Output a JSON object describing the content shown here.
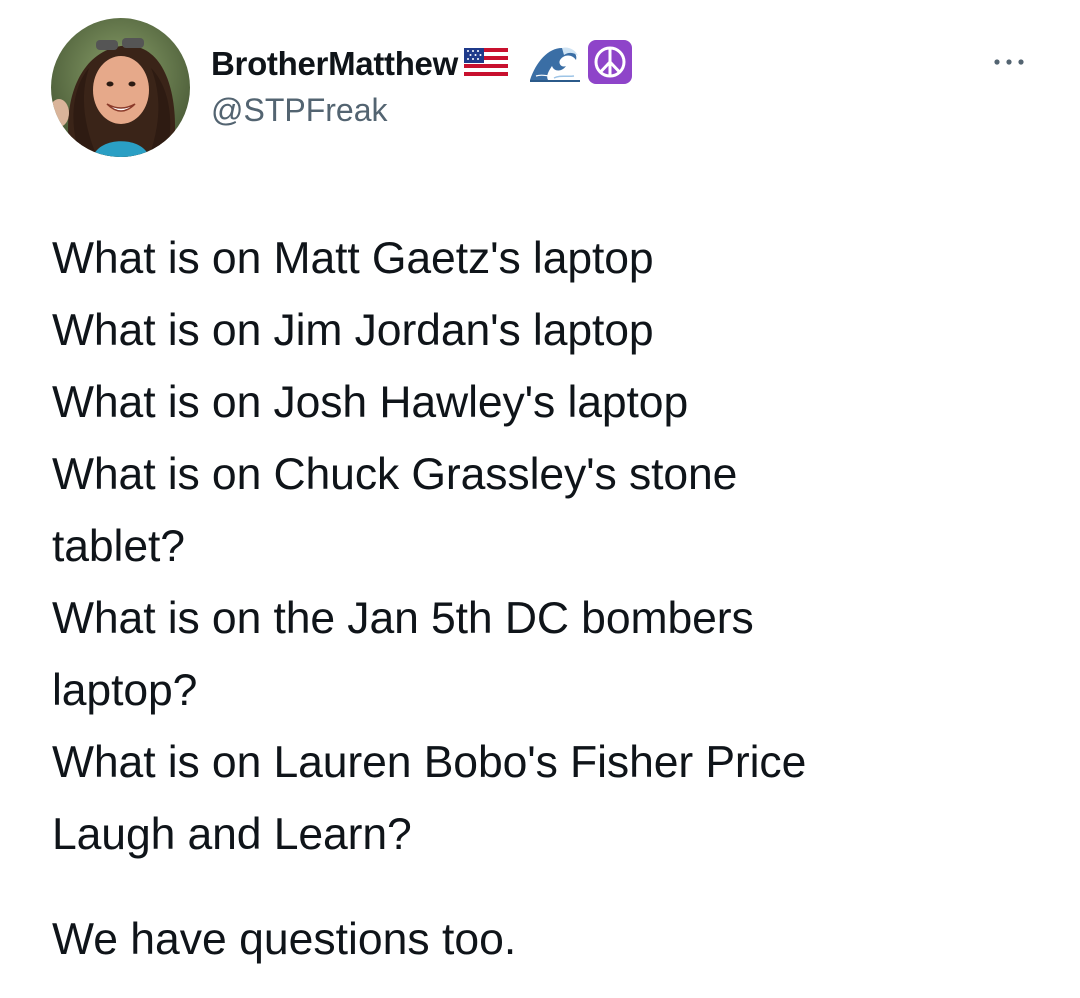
{
  "author": {
    "display_name": "BrotherMatthew",
    "name_emojis": [
      "us-flag-icon",
      "wave-icon",
      "peace-symbol-icon"
    ],
    "handle": "@STPFreak"
  },
  "menu": {
    "icon": "more-horizontal-icon"
  },
  "tweet": {
    "lines": [
      "What is on Matt Gaetz's laptop",
      "What is on Jim Jordan's laptop",
      "What is on Josh Hawley's laptop",
      "What is on Chuck Grassley's stone",
      "tablet?",
      "What is on the Jan 5th DC bombers",
      "laptop?",
      "What is on Lauren Bobo's Fisher Price",
      "Laugh and Learn?"
    ],
    "closing": "We have questions too."
  },
  "colors": {
    "text_primary": "#0f1419",
    "text_secondary": "#536471",
    "peace_purple": "#8e44c9",
    "flag_red": "#c8102e",
    "flag_blue": "#1f3a8a"
  }
}
